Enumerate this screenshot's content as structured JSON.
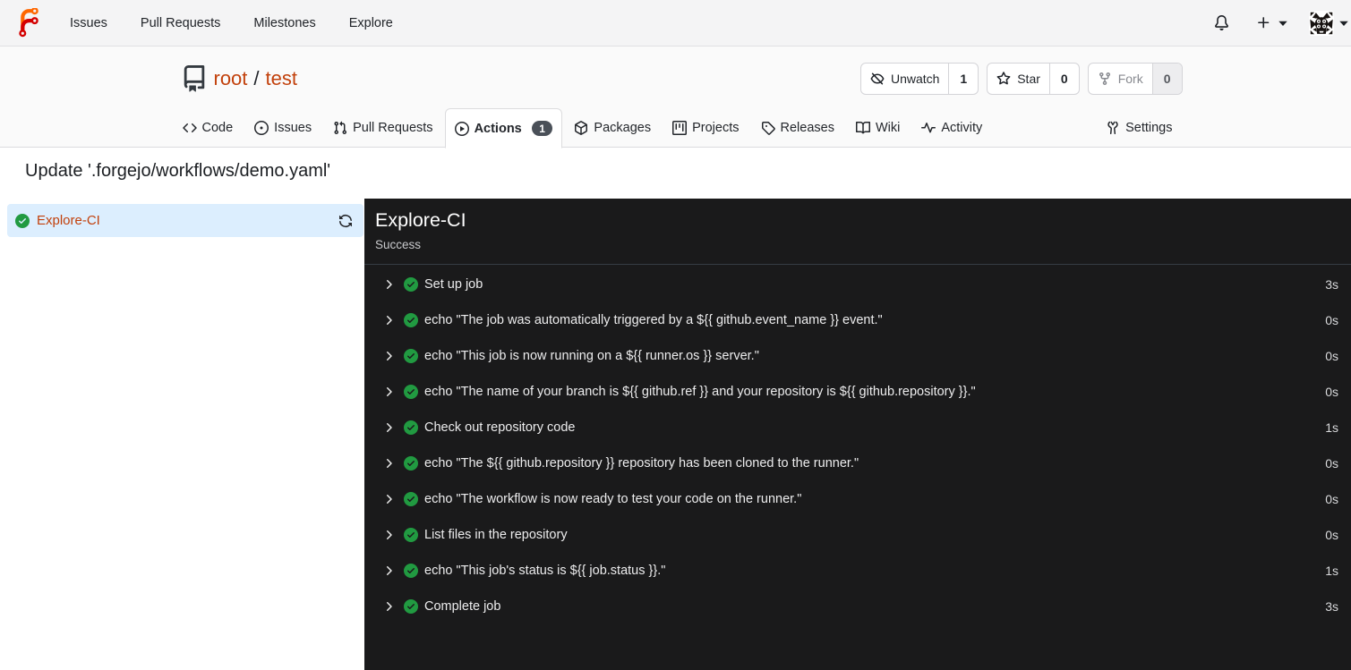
{
  "navbar": {
    "links": [
      {
        "label": "Issues"
      },
      {
        "label": "Pull Requests"
      },
      {
        "label": "Milestones"
      },
      {
        "label": "Explore"
      }
    ]
  },
  "repo_header": {
    "owner": "root",
    "separator": "/",
    "name": "test",
    "buttons": {
      "unwatch": {
        "label": "Unwatch",
        "count": "1"
      },
      "star": {
        "label": "Star",
        "count": "0"
      },
      "fork": {
        "label": "Fork",
        "count": "0"
      }
    }
  },
  "tabs": {
    "items": [
      {
        "label": "Code"
      },
      {
        "label": "Issues"
      },
      {
        "label": "Pull Requests"
      },
      {
        "label": "Actions",
        "badge": "1"
      },
      {
        "label": "Packages"
      },
      {
        "label": "Projects"
      },
      {
        "label": "Releases"
      },
      {
        "label": "Wiki"
      },
      {
        "label": "Activity"
      }
    ],
    "settings": {
      "label": "Settings"
    }
  },
  "run": {
    "title": "Update '.forgejo/workflows/demo.yaml'",
    "sidebar_job": {
      "name": "Explore-CI"
    },
    "panel": {
      "job_name": "Explore-CI",
      "status": "Success"
    },
    "steps": [
      {
        "name": "Set up job",
        "duration": "3s"
      },
      {
        "name": "echo \"The job was automatically triggered by a ${{ github.event_name }} event.\"",
        "duration": "0s"
      },
      {
        "name": "echo \"This job is now running on a ${{ runner.os }} server.\"",
        "duration": "0s"
      },
      {
        "name": "echo \"The name of your branch is ${{ github.ref }} and your repository is ${{ github.repository }}.\"",
        "duration": "0s"
      },
      {
        "name": "Check out repository code",
        "duration": "1s"
      },
      {
        "name": "echo \"The ${{ github.repository }} repository has been cloned to the runner.\"",
        "duration": "0s"
      },
      {
        "name": "echo \"The workflow is now ready to test your code on the runner.\"",
        "duration": "0s"
      },
      {
        "name": "List files in the repository",
        "duration": "0s"
      },
      {
        "name": "echo \"This job's status is ${{ job.status }}.\"",
        "duration": "1s"
      },
      {
        "name": "Complete job",
        "duration": "3s"
      }
    ]
  },
  "colors": {
    "accent_link": "#c2410c",
    "success_green": "#219a41",
    "selected_job_bg": "#dceefe",
    "console_bg": "#1a1a1b"
  }
}
